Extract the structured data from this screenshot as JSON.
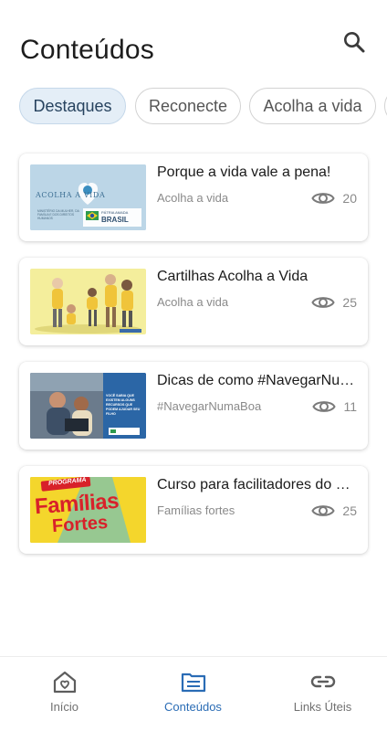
{
  "header": {
    "title": "Conteúdos",
    "search_icon": "search-icon"
  },
  "chips": [
    {
      "label": "Destaques",
      "active": true
    },
    {
      "label": "Reconecte",
      "active": false
    },
    {
      "label": "Acolha a vida",
      "active": false
    }
  ],
  "items": [
    {
      "title": "Porque a vida vale a pena!",
      "category": "Acolha a vida",
      "views": "20",
      "thumb": {
        "heading": "ACOLHA A VIDA",
        "footnote": "MINISTÉRIO DA MULHER, DA FAMÍLIA E DOS DIREITOS HUMANOS",
        "brand_line1": "PÁTRIA AMADA",
        "brand_line2": "BRASIL"
      }
    },
    {
      "title": "Cartilhas Acolha a Vida",
      "category": "Acolha a vida",
      "views": "25"
    },
    {
      "title": "Dicas de como #NavegarNumaBoa",
      "category": "#NavegarNumaBoa",
      "views": "11",
      "thumb": {
        "text": "VOCÊ SABIA QUE EXISTEM ALGUNS RECURSOS QUE PODEM AJUDAR SEU FILHO"
      }
    },
    {
      "title": "Curso para facilitadores do Famílias Fortes",
      "category": "Famílias fortes",
      "views": "25",
      "thumb": {
        "tag": "PROGRAMA",
        "line1": "Famílias",
        "line2": "Fortes"
      }
    }
  ],
  "bottom_nav": [
    {
      "label": "Início",
      "icon": "home-heart-icon",
      "active": false
    },
    {
      "label": "Conteúdos",
      "icon": "content-list-icon",
      "active": true
    },
    {
      "label": "Links Úteis",
      "icon": "link-icon",
      "active": false
    }
  ],
  "colors": {
    "accent": "#2a6cb5",
    "chip_active_bg": "#e4eef7",
    "muted_text": "#8a8a8a"
  }
}
